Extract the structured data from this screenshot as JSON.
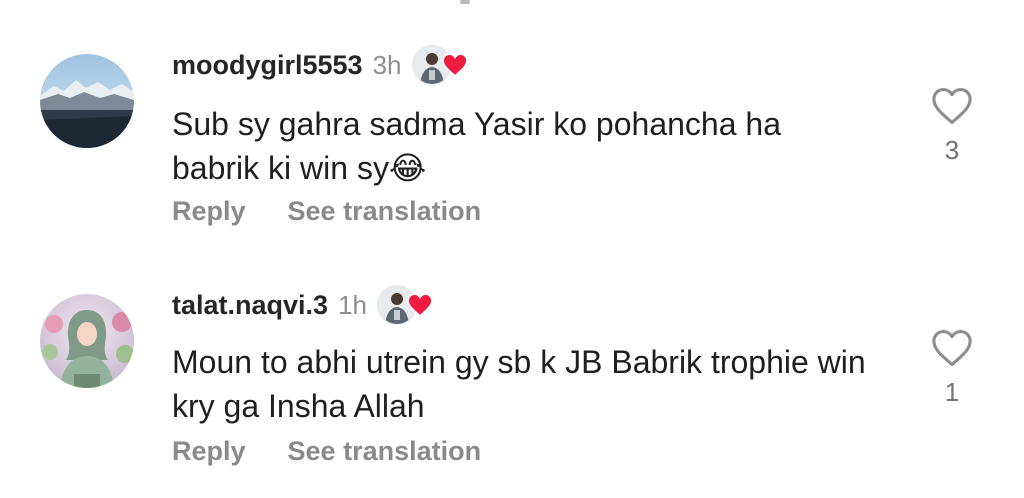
{
  "comments": [
    {
      "username": "moodygirl5553",
      "time": "3h",
      "text": "Sub sy gahra sadma Yasir ko pohancha ha babrik ki win sy😂",
      "reply_label": "Reply",
      "translate_label": "See translation",
      "like_count": "3",
      "avatar_icon": "mountain-landscape-avatar",
      "reaction_icon": "creator-heart-icon"
    },
    {
      "username": "talat.naqvi.3",
      "time": "1h",
      "text": "Moun to abhi utrein gy sb k JB Babrik trophie win kry ga Insha Allah",
      "reply_label": "Reply",
      "translate_label": "See translation",
      "like_count": "1",
      "avatar_icon": "hijab-girl-avatar",
      "reaction_icon": "creator-heart-icon"
    }
  ],
  "colors": {
    "username": "#262626",
    "secondary_text": "#8e8e8e",
    "heart_red": "#ed1c40",
    "outline_heart": "#8e8e8e"
  }
}
